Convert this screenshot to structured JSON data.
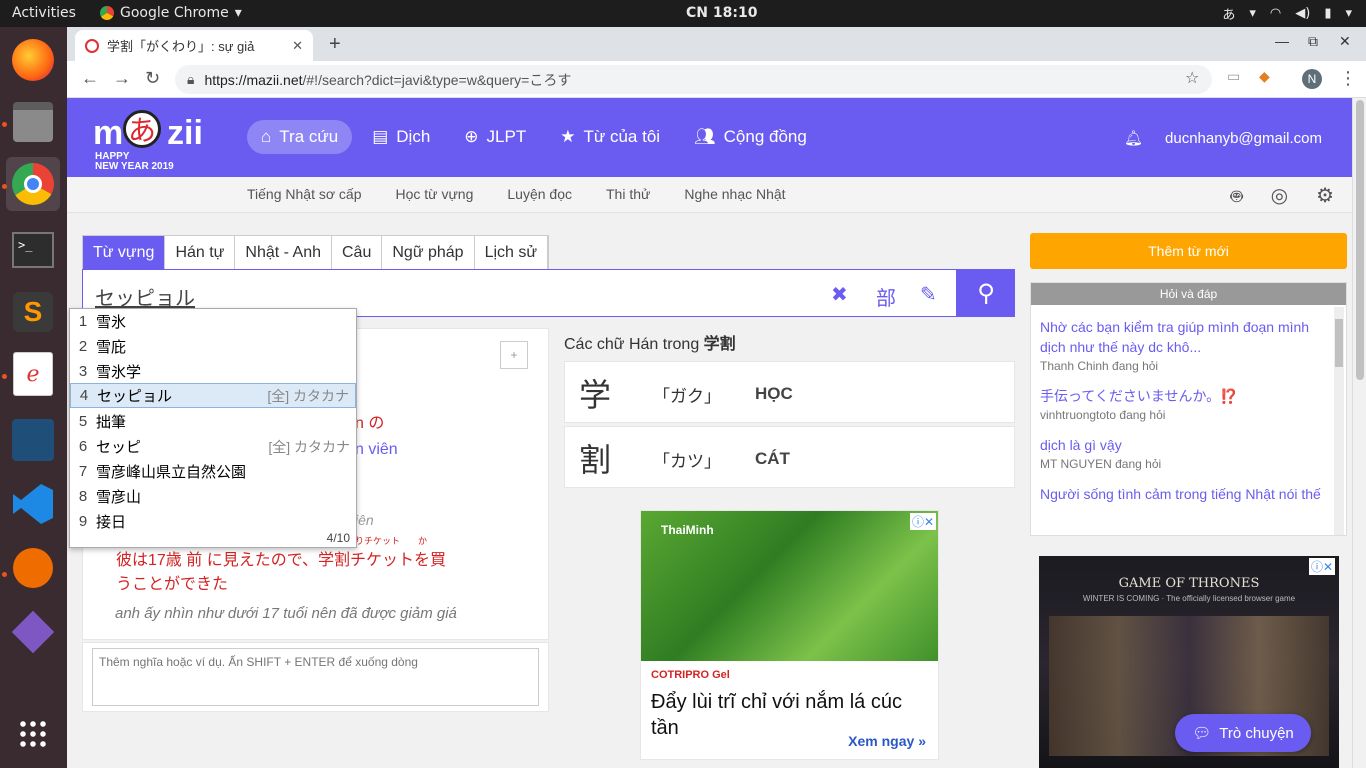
{
  "os": {
    "activities": "Activities",
    "app_name": "Google Chrome",
    "clock": "CN 18:10",
    "ime": "あ"
  },
  "browser": {
    "tab_title": "学割「がくわり」: sự giả",
    "url_host": "https://mazii.net",
    "url_rest": "/#!/search?dict=javi&type=w&query=ころす",
    "profile_initial": "N"
  },
  "header": {
    "logo_m": "m",
    "logo_a": "あ",
    "logo_zii": "zii",
    "logo_happy": "HAPPY",
    "logo_newyear": "NEW YEAR 2019",
    "nav": [
      {
        "label": "Tra cứu",
        "icon": "home-icon"
      },
      {
        "label": "Dịch",
        "icon": "translate-icon"
      },
      {
        "label": "JLPT",
        "icon": "search-plus-icon"
      },
      {
        "label": "Từ của tôi",
        "icon": "star-icon"
      },
      {
        "label": "Cộng đồng",
        "icon": "users-icon"
      }
    ],
    "user_email": "ducnhanyb@gmail.com"
  },
  "subnav": [
    "Tiếng Nhật sơ cấp",
    "Học từ vựng",
    "Luyện đọc",
    "Thi thử",
    "Nghe nhạc Nhật"
  ],
  "search": {
    "tabs": [
      "Từ vựng",
      "Hán tự",
      "Nhật - Anh",
      "Câu",
      "Ngữ pháp",
      "Lịch sử"
    ],
    "active_tab": "Từ vựng",
    "query": "セッピョル",
    "radical_label": "部"
  },
  "autocomplete": {
    "items": [
      {
        "n": "1",
        "word": "雪氷",
        "hint": ""
      },
      {
        "n": "2",
        "word": "雪庇",
        "hint": ""
      },
      {
        "n": "3",
        "word": "雪氷学",
        "hint": ""
      },
      {
        "n": "4",
        "word": "セッピョル",
        "hint": "[全] カタカナ"
      },
      {
        "n": "5",
        "word": "拙筆",
        "hint": ""
      },
      {
        "n": "6",
        "word": "セッピ",
        "hint": "[全] カタカナ"
      },
      {
        "n": "7",
        "word": "雪彦峰山県立自然公園",
        "hint": ""
      },
      {
        "n": "8",
        "word": "雪彦山",
        "hint": ""
      },
      {
        "n": "9",
        "word": "接日",
        "hint": ""
      }
    ],
    "footer": "4/10"
  },
  "result": {
    "frag1": "n の",
    "frag2": "n viên",
    "frag3": "iên",
    "furigana": "りチケット　　か",
    "example_jp": "彼は17歳 前 に見えたので、学割チケットを買うことができた",
    "example_vi": "anh ấy nhìn như dưới 17 tuổi nên đã được giảm giá",
    "note_placeholder": "Thêm nghĩa hoặc ví dụ. Ấn SHIFT + ENTER để xuống dòng",
    "plus": "+"
  },
  "kanji": {
    "title_prefix": "Các chữ Hán trong ",
    "title_word": "学割",
    "items": [
      {
        "k": "学",
        "reading": "「ガク」",
        "hanviet": "HỌC"
      },
      {
        "k": "割",
        "reading": "「カツ」",
        "hanviet": "CÁT"
      }
    ]
  },
  "ad": {
    "img_brand": "ThaiMinh",
    "brand": "COTRIPRO Gel",
    "copy": "Đẩy lùi trĩ chỉ với nắm lá cúc tần",
    "cta": "Xem ngay »"
  },
  "sidebar": {
    "add_word": "Thêm từ mới",
    "qa_title": "Hỏi và đáp",
    "qa": [
      {
        "q": "Nhờ các bạn kiểm tra giúp mình đoạn mình dịch như thế này dc khô...",
        "by": "Thanh Chinh đang hỏi"
      },
      {
        "q": "手伝ってくださいませんか。⁉️",
        "by": "vinhtruongtoto đang hỏi"
      },
      {
        "q": "dịch là gì vậy",
        "by": "MT NGUYEN đang hỏi"
      },
      {
        "q": "Người sống tình cảm trong tiếng Nhật nói thế",
        "by": ""
      }
    ],
    "got_title": "GAME OF THRONES",
    "got_sub": "WINTER IS COMING",
    "got_tag": "The officially licensed browser game",
    "chat": "Trò chuyện"
  },
  "colors": {
    "brand": "#6a5cf0",
    "accent": "#ffa500",
    "red_text": "#d42323"
  }
}
